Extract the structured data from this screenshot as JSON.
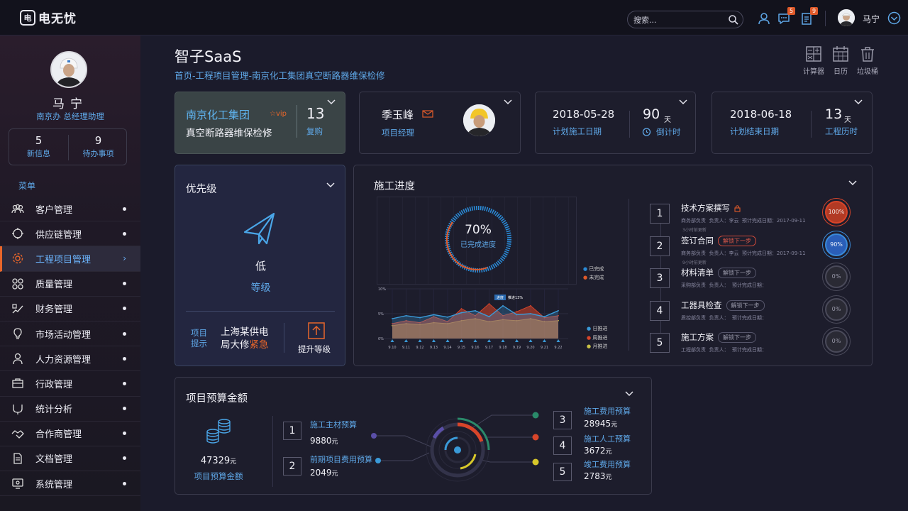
{
  "topbar": {
    "logo_mark": "电",
    "logo_text": "电无忧",
    "search_placeholder": "搜索...",
    "messages_badge": "5",
    "tasks_badge": "9",
    "user_name": "马宁",
    "icons": [
      "user-icon",
      "chat-icon",
      "clipboard-icon",
      "chevron-down-circle-icon",
      "search-icon"
    ]
  },
  "sidebar": {
    "name": "马宁",
    "role": "南京办  总经理助理",
    "stats": [
      {
        "value": "5",
        "label": "新信息"
      },
      {
        "value": "9",
        "label": "待办事项"
      }
    ],
    "menu_title": "菜单",
    "items": [
      {
        "label": "客户管理",
        "icon": "customers-icon"
      },
      {
        "label": "供应链管理",
        "icon": "supply-chain-icon"
      },
      {
        "label": "工程项目管理",
        "icon": "gear-icon",
        "active": true
      },
      {
        "label": "质量管理",
        "icon": "quality-icon"
      },
      {
        "label": "财务管理",
        "icon": "finance-icon"
      },
      {
        "label": "市场活动管理",
        "icon": "lightbulb-icon"
      },
      {
        "label": "人力资源管理",
        "icon": "person-icon"
      },
      {
        "label": "行政管理",
        "icon": "briefcase-icon"
      },
      {
        "label": "统计分析",
        "icon": "analytics-icon"
      },
      {
        "label": "合作商管理",
        "icon": "handshake-icon"
      },
      {
        "label": "文档管理",
        "icon": "document-icon"
      },
      {
        "label": "系统管理",
        "icon": "settings-icon"
      }
    ]
  },
  "header": {
    "title": "智子SaaS",
    "breadcrumb": "首页-工程项目管理-南京化工集团真空断路器维保检修",
    "tools": [
      {
        "label": "计算器",
        "icon": "calculator-icon"
      },
      {
        "label": "日历",
        "icon": "calendar-icon"
      },
      {
        "label": "垃圾桶",
        "icon": "trash-icon"
      }
    ]
  },
  "project_card": {
    "company": "南京化工集团",
    "vip": "vip",
    "project": "真空断路器维保检修",
    "count": "13",
    "count_label": "复购"
  },
  "manager_card": {
    "name": "季玉峰",
    "role": "项目经理"
  },
  "start_card": {
    "date": "2018-05-28",
    "date_label": "计划施工日期",
    "days": "90",
    "unit": "天",
    "days_label": "倒计时"
  },
  "end_card": {
    "date": "2018-06-18",
    "date_label": "计划结束日期",
    "days": "13",
    "unit": "天",
    "days_label": "工程历时"
  },
  "priority_card": {
    "title": "优先级",
    "level": "低",
    "level_label": "等级",
    "hint_label_1": "项目",
    "hint_label_2": "提示",
    "hint_text_1": "上海某供电",
    "hint_text_2": "局大修",
    "hint_urgent": "紧急",
    "upgrade_label": "提升等级"
  },
  "progress_card": {
    "title": "施工进度",
    "percent": "70%",
    "percent_label": "已完成进度",
    "legend_done": "已完成",
    "legend_undone": "未完成",
    "tooltip_label": "进度",
    "tooltip_value": "推进13%",
    "y_ticks": [
      "10%",
      "5%",
      "0%"
    ],
    "area_legend": [
      "日推进",
      "周推进",
      "月推进"
    ],
    "steps": [
      {
        "no": "1",
        "title": "技术方案撰写",
        "dept": "商务部负责",
        "person": "负责人：李云",
        "due": "预计完成日期：2017-09-11",
        "note": "3小时前更新",
        "percent": "100%",
        "locked": true
      },
      {
        "no": "2",
        "title": "签订合同",
        "pill": "解锁下一步",
        "dept": "商务部负责",
        "person": "负责人：李云",
        "due": "预计完成日期：2017-09-11",
        "note": "9小时前更新",
        "percent": "90%"
      },
      {
        "no": "3",
        "title": "材料清单",
        "pill": "解锁下一步",
        "dept": "采购部负责",
        "person": "负责人：",
        "due": "预计完成日期：",
        "percent": "0%"
      },
      {
        "no": "4",
        "title": "工器具检查",
        "pill": "解锁下一步",
        "dept": "质控部负责",
        "person": "负责人：",
        "due": "预计完成日期：",
        "percent": "0%"
      },
      {
        "no": "5",
        "title": "施工方案",
        "pill": "解锁下一步",
        "dept": "工程部负责",
        "person": "负责人：",
        "due": "预计完成日期：",
        "percent": "0%"
      }
    ]
  },
  "budget_card": {
    "title": "项目预算金额",
    "total": "47329",
    "unit": "元",
    "total_label": "项目预算金额",
    "items": [
      {
        "no": "1",
        "label": "施工主材预算",
        "value": "9880",
        "color": "#5a4fa8"
      },
      {
        "no": "2",
        "label": "前期项目费用预算",
        "value": "2049",
        "color": "#3a9ad8"
      },
      {
        "no": "3",
        "label": "施工费用预算",
        "value": "28945",
        "color": "#2a8a6a"
      },
      {
        "no": "4",
        "label": "施工人工预算",
        "value": "3672",
        "color": "#d8452a"
      },
      {
        "no": "5",
        "label": "竣工费用预算",
        "value": "2783",
        "color": "#d8c82a"
      }
    ]
  },
  "chart_data": {
    "type": "area",
    "x": [
      "9.10",
      "9.11",
      "9.12",
      "9.13",
      "9.14",
      "9.15",
      "9.16",
      "9.17",
      "9.18",
      "9.19",
      "9.20",
      "9.21",
      "9.22"
    ],
    "ylim": [
      0,
      10
    ],
    "series": [
      {
        "name": "日推进",
        "values": [
          4.0,
          4.6,
          4.2,
          4.8,
          4.3,
          5.2,
          5.6,
          4.4,
          6.6,
          4.8,
          5.0,
          4.4,
          5.6
        ],
        "color": "#3a9ad8"
      },
      {
        "name": "周推进",
        "values": [
          3.0,
          3.6,
          3.2,
          4.4,
          3.4,
          6.0,
          4.6,
          7.0,
          4.6,
          5.4,
          6.6,
          4.2,
          4.6
        ],
        "color": "#d8452a"
      },
      {
        "name": "月推进",
        "values": [
          2.6,
          3.0,
          2.8,
          3.2,
          3.0,
          3.6,
          4.0,
          3.4,
          3.8,
          3.6,
          4.0,
          3.4,
          3.6
        ],
        "color": "#c9c246"
      }
    ]
  },
  "colors": {
    "accent": "#5fa8e8",
    "alert": "#e8662a",
    "done": "#3a9ad8",
    "undone": "#e05a2a"
  }
}
